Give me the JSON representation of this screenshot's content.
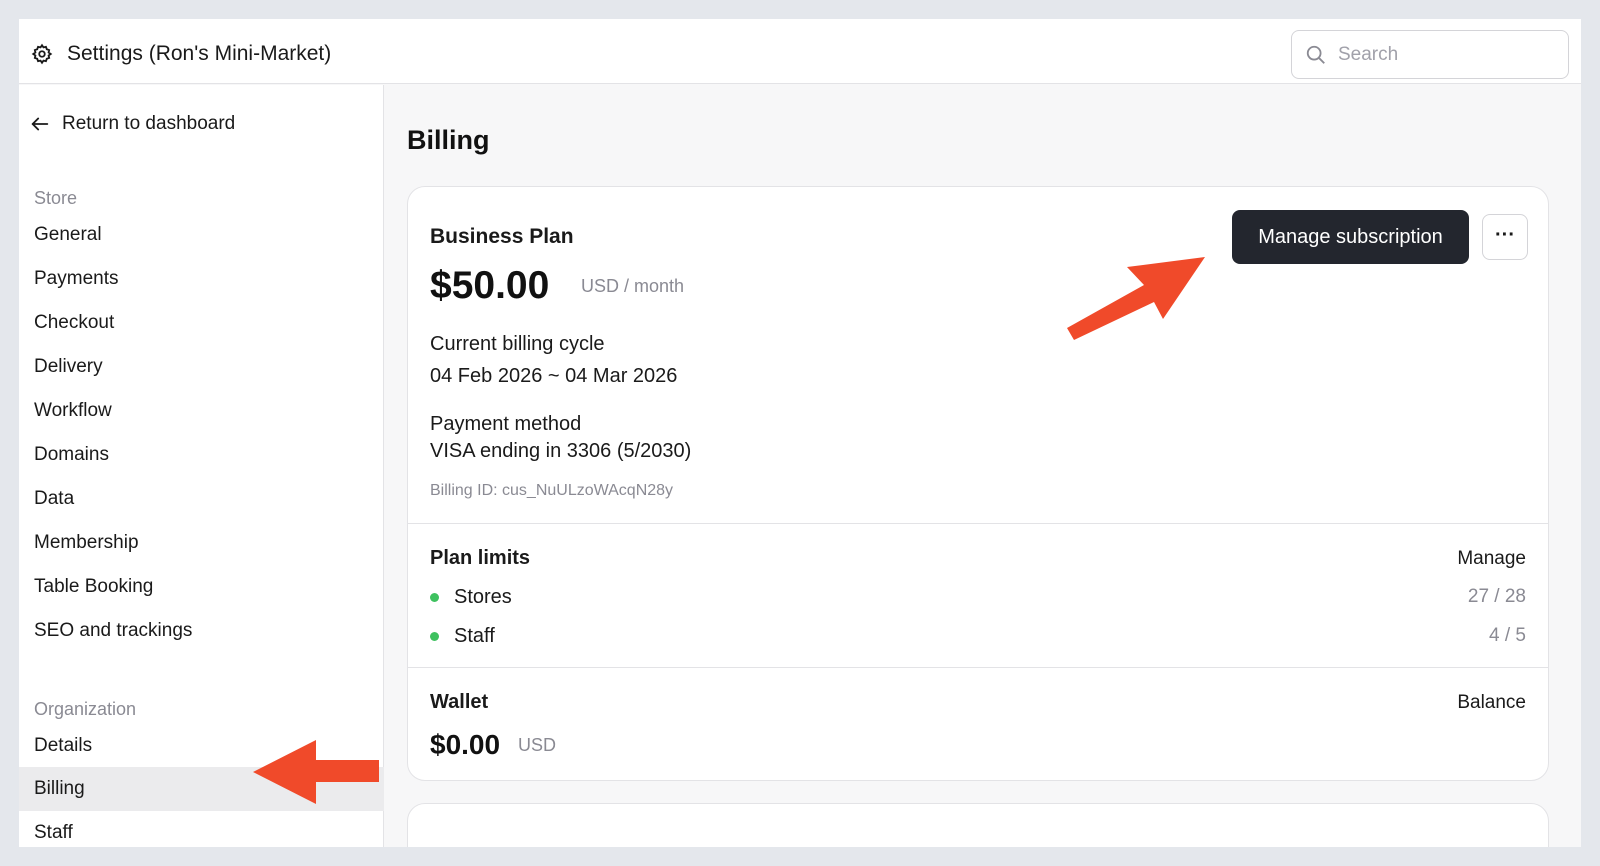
{
  "header": {
    "title": "Settings (Ron's Mini-Market)",
    "search_placeholder": "Search"
  },
  "sidebar": {
    "back_label": "Return to dashboard",
    "store_heading": "Store",
    "store_items": [
      "General",
      "Payments",
      "Checkout",
      "Delivery",
      "Workflow",
      "Domains",
      "Data",
      "Membership",
      "Table Booking",
      "SEO and trackings"
    ],
    "org_heading": "Organization",
    "org_items": [
      "Details",
      "Billing",
      "Staff"
    ],
    "active_item": "Billing"
  },
  "main": {
    "page_title": "Billing",
    "plan": {
      "name": "Business Plan",
      "price": "$50.00",
      "price_unit": "USD / month",
      "cycle_label": "Current billing cycle",
      "cycle_value": "04 Feb 2026 ~ 04 Mar 2026",
      "payment_label": "Payment method",
      "payment_value": "VISA ending in 3306 (5/2030)",
      "billing_id": "Billing ID: cus_NuULzoWAcqN28y",
      "manage_button": "Manage subscription",
      "more_button": "···"
    },
    "limits": {
      "title": "Plan limits",
      "manage_link": "Manage",
      "items": [
        {
          "name": "Stores",
          "count": "27 / 28",
          "status_color": "#3ec15f"
        },
        {
          "name": "Staff",
          "count": "4 / 5",
          "status_color": "#3ec15f"
        }
      ]
    },
    "wallet": {
      "title": "Wallet",
      "balance_label": "Balance",
      "amount": "$0.00",
      "currency": "USD"
    }
  },
  "colors": {
    "annotation_arrow": "#f04a2a",
    "primary_button": "#23262e",
    "status_ok": "#3ec15f"
  }
}
